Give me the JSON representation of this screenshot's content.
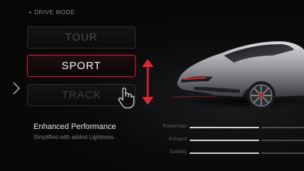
{
  "header": {
    "title": "+ DRIVE MODE"
  },
  "modes": [
    {
      "label": "TOUR",
      "state": "inactive"
    },
    {
      "label": "SPORT",
      "state": "selected"
    },
    {
      "label": "TRACK",
      "state": "inactive"
    }
  ],
  "description": {
    "title": "Enhanced Performance",
    "subtitle": "Simplified with added Lightness."
  },
  "stats": [
    {
      "label": "Powertrain",
      "level": 0.62
    },
    {
      "label": "Exhaust",
      "level": 0.62
    },
    {
      "label": "Stability",
      "level": 0.62
    }
  ],
  "colors": {
    "accent": "#c8202c",
    "background": "#050505",
    "inactive_text": "#4a4a4a"
  },
  "icons": {
    "side": "chevron-left-icon",
    "gesture": "up-down-arrow-icon",
    "pointer": "hand-pointer-icon"
  }
}
